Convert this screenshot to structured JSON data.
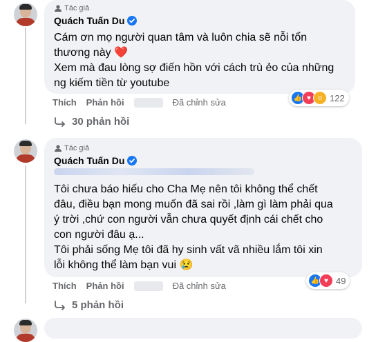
{
  "comments": [
    {
      "author_badge": "Tác giả",
      "author_name": "Quách Tuấn Du",
      "text_lines": [
        "Cám ơn mọ người quan tâm và luôn chia sẽ nỗi tổn",
        "thương này ❤️",
        "Xem mà đau lòng sợ điến hồn với cách trù ẻo của những",
        "ng kiếm tiền từ youtube"
      ],
      "actions": {
        "like": "Thích",
        "reply": "Phản hồi",
        "edited": "Đã chỉnh sửa"
      },
      "reaction_count": "122",
      "replies_label": "30 phản hồi"
    },
    {
      "author_badge": "Tác giả",
      "author_name": "Quách Tuấn Du",
      "text_lines": [
        "Tôi chưa báo hiếu cho Cha Mẹ nên tôi không thể chết",
        "đâu, điều bạn mong muốn đã sai rồi ,làm gì làm phải qua",
        "ý trời ,chứ con người vẫn chưa quyết định cái chết cho",
        "con người đâu ạ...",
        "Tôi phải sống Mẹ tôi đã hy sinh vất vã nhiều lắm tôi xin",
        "lỗi không thể làm bạn vui 😢"
      ],
      "actions": {
        "like": "Thích",
        "reply": "Phản hồi",
        "edited": "Đã chỉnh sửa"
      },
      "reaction_count": "49",
      "replies_label": "5 phản hồi"
    }
  ],
  "colors": {
    "like": "#1877f2",
    "love": "#f33e58",
    "care": "#f7b125",
    "verified": "#1877f2"
  }
}
